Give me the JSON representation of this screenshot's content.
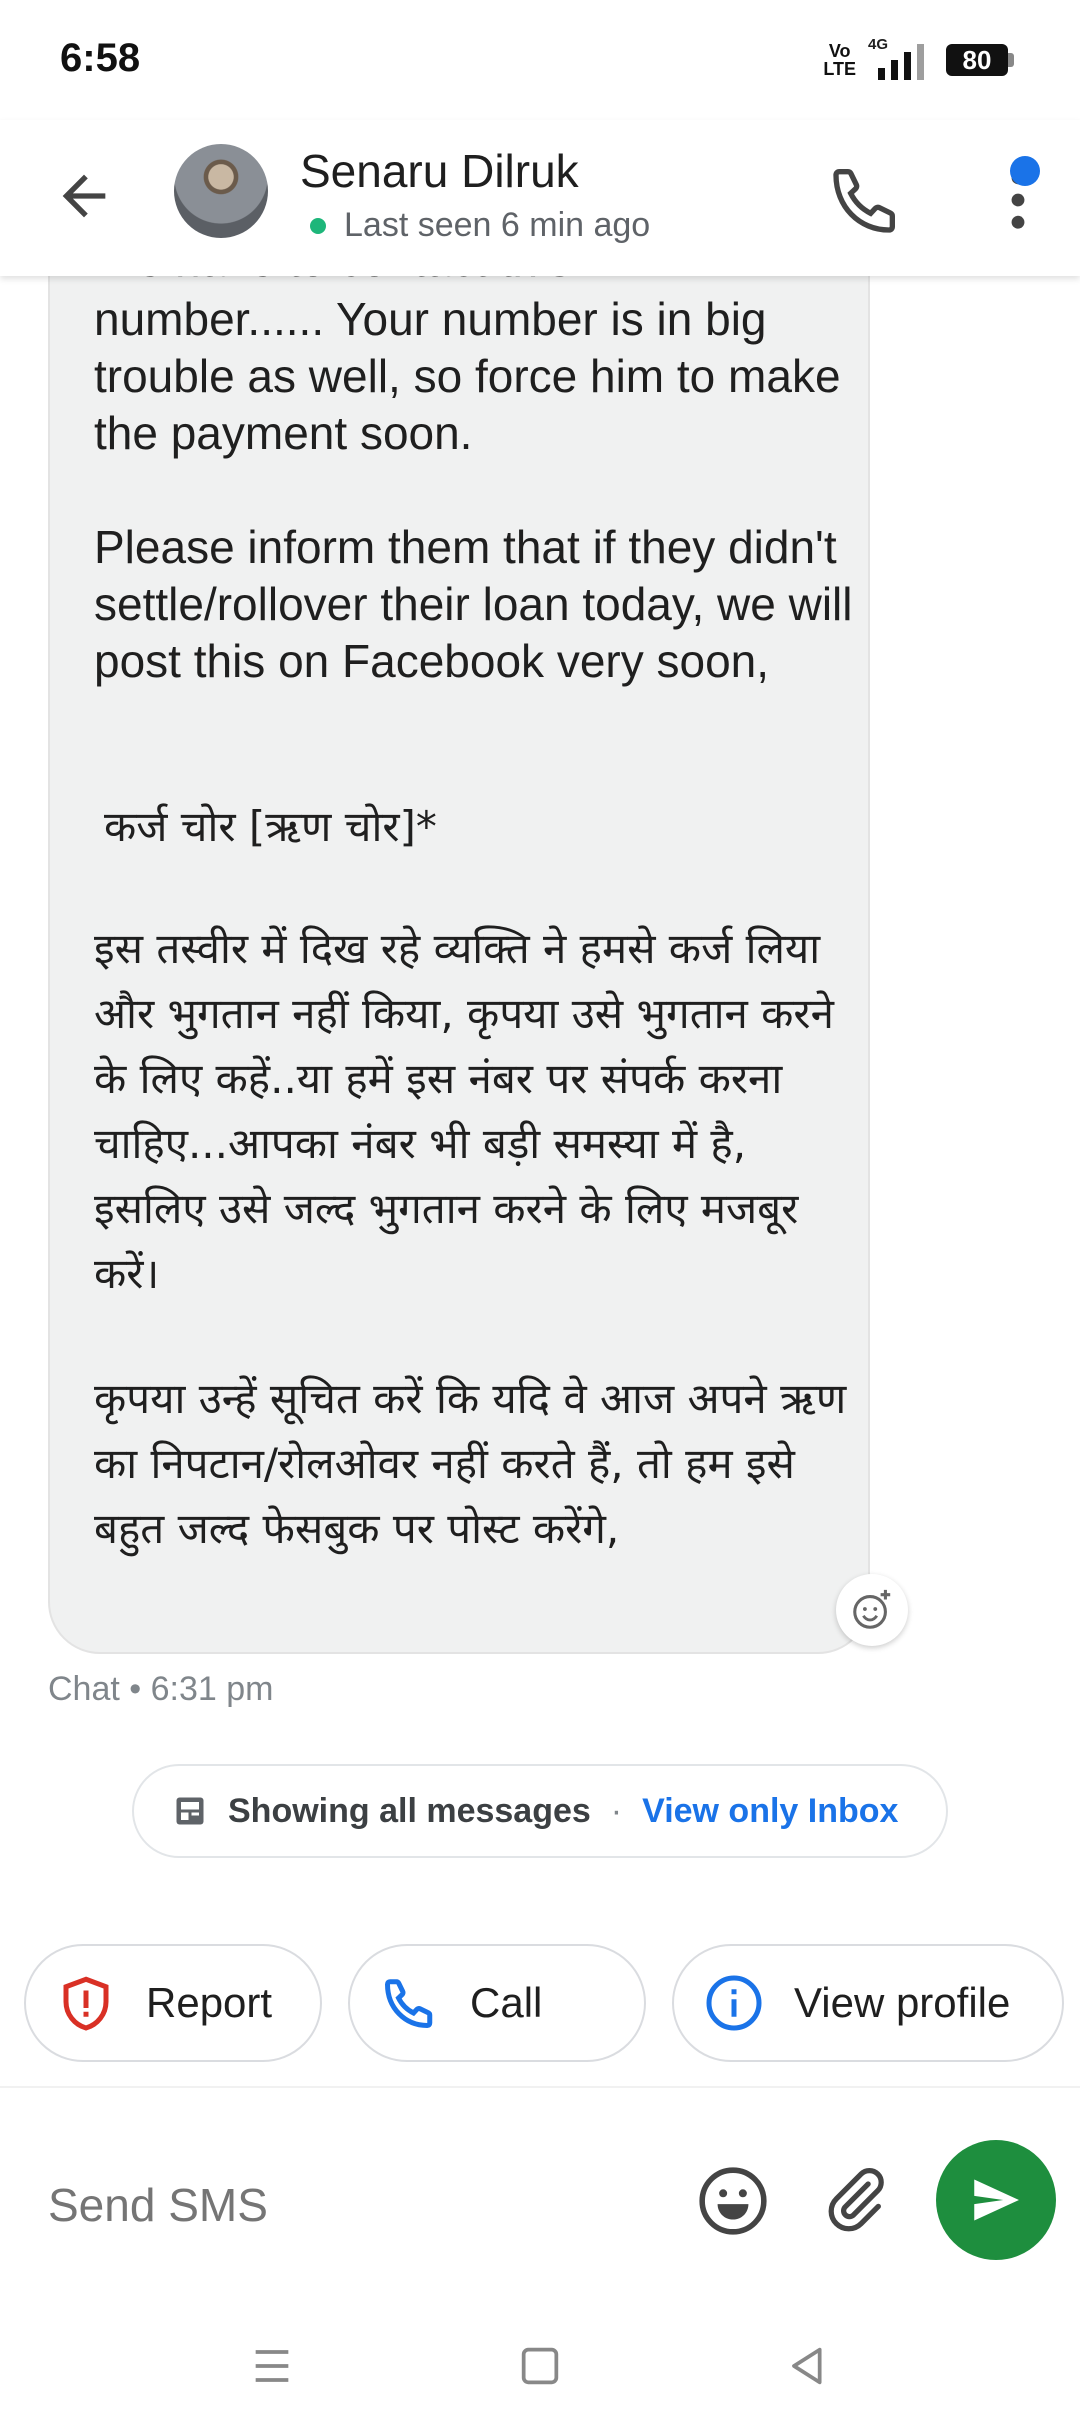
{
  "status_bar": {
    "time": "6:58",
    "volte_top": "Vo",
    "volte_bottom": "LTE",
    "network": "4G",
    "battery": "80"
  },
  "header": {
    "contact_name": "Senaru Dilruk",
    "last_seen": "Last seen 6 min ago",
    "back_icon": "arrow-back-icon",
    "call_icon": "phone-icon",
    "more_icon": "more-vert-icon",
    "online_color": "#1db67a",
    "badge_color": "#1a73e8"
  },
  "message": {
    "cut_line": "We have to contact this",
    "para_en1": "number...... Your number is in big trouble as well, so force him to make the payment soon.",
    "para_en2": "Please inform them that if they didn't settle/rollover their loan today, we will post this on Facebook very soon,",
    "para_hi_title": "कर्ज चोर [ऋण चोर]*",
    "para_hi1": "इस तस्वीर में दिख रहे व्यक्ति ने हमसे कर्ज लिया और भुगतान नहीं किया, कृपया उसे भुगतान करने के लिए कहें..या हमें इस नंबर पर संपर्क करना चाहिए...आपका नंबर भी बड़ी समस्या में है, इसलिए उसे जल्द भुगतान करने के लिए मजबूर करें।",
    "para_hi2": "कृपया उन्हें सूचित करें कि यदि वे आज अपने ऋण का निपटान/रोलओवर नहीं करते हैं, तो हम इसे बहुत जल्द फेसबुक पर पोस्ट करेंगे,",
    "meta": "Chat • 6:31 pm"
  },
  "filter": {
    "showing": "Showing all messages",
    "separator": "·",
    "view_only_inbox": "View only Inbox"
  },
  "actions": {
    "report": "Report",
    "call": "Call",
    "view_profile": "View profile",
    "report_color": "#d93025",
    "call_color": "#1a73e8",
    "profile_color": "#1a73e8"
  },
  "compose": {
    "placeholder": "Send SMS",
    "send_color": "#1e8e3e"
  }
}
